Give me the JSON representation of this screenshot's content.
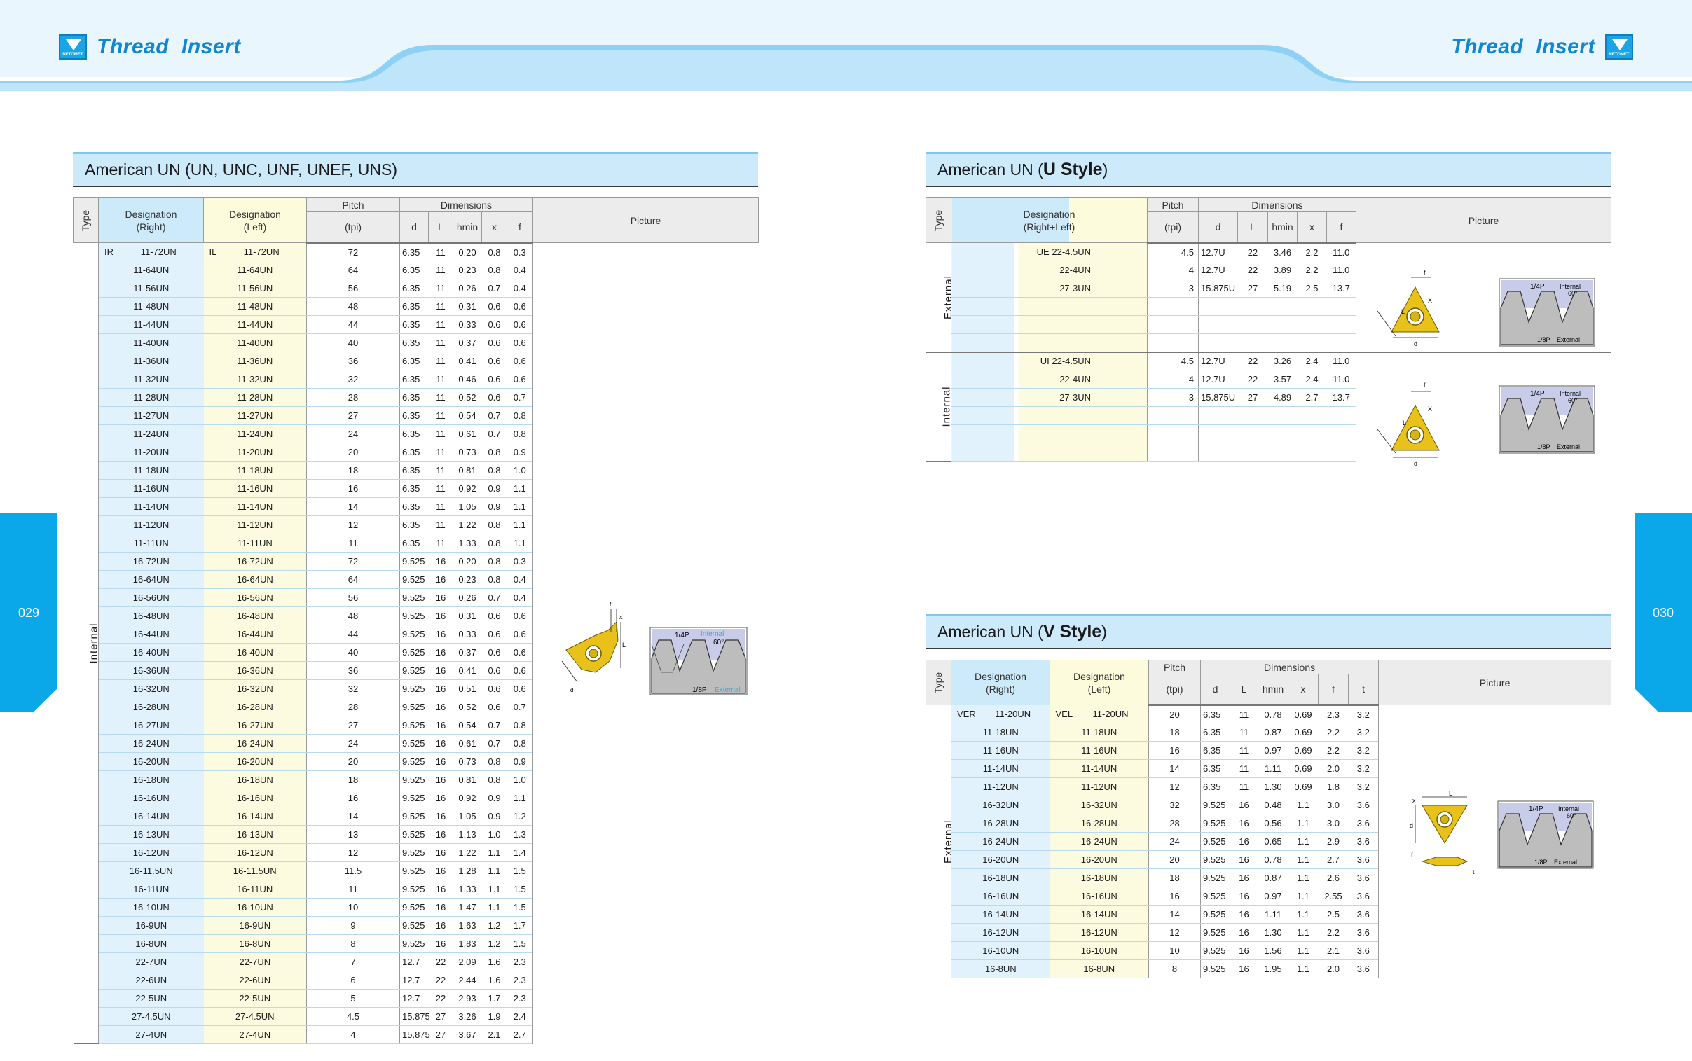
{
  "header": {
    "brand_left": {
      "word1": "Thread",
      "word2": "Insert"
    },
    "brand_right": {
      "word1": "Thread",
      "word2": "Insert"
    },
    "logo_text": "NETOMET"
  },
  "pages": {
    "left": "029",
    "right": "030"
  },
  "colors": {
    "accent": "#0aa8e8",
    "title_bar": "#cdeafb",
    "right_cell": "#e2f2fd",
    "left_cell": "#fcfbe0",
    "insert_gold": "#e8c21a"
  },
  "un_table": {
    "title": "American UN (UN, UNC, UNF, UNEF, UNS)",
    "headers": {
      "type": "Type",
      "designation_right": "Designation\n(Right)",
      "designation_left": "Designation\n(Left)",
      "pitch": "Pitch",
      "tpi": "(tpi)",
      "dimensions": "Dimensions",
      "d": "d",
      "L": "L",
      "hmin": "hmin",
      "x": "x",
      "f": "f",
      "picture": "Picture"
    },
    "type_label": "Internal",
    "prefix_right": "IR",
    "prefix_left": "IL",
    "rows": [
      [
        "11-72UN",
        "11-72UN",
        "72",
        "6.35",
        "11",
        "0.20",
        "0.8",
        "0.3"
      ],
      [
        "11-64UN",
        "11-64UN",
        "64",
        "6.35",
        "11",
        "0.23",
        "0.8",
        "0.4"
      ],
      [
        "11-56UN",
        "11-56UN",
        "56",
        "6.35",
        "11",
        "0.26",
        "0.7",
        "0.4"
      ],
      [
        "11-48UN",
        "11-48UN",
        "48",
        "6.35",
        "11",
        "0.31",
        "0.6",
        "0.6"
      ],
      [
        "11-44UN",
        "11-44UN",
        "44",
        "6.35",
        "11",
        "0.33",
        "0.6",
        "0.6"
      ],
      [
        "11-40UN",
        "11-40UN",
        "40",
        "6.35",
        "11",
        "0.37",
        "0.6",
        "0.6"
      ],
      [
        "11-36UN",
        "11-36UN",
        "36",
        "6.35",
        "11",
        "0.41",
        "0.6",
        "0.6"
      ],
      [
        "11-32UN",
        "11-32UN",
        "32",
        "6.35",
        "11",
        "0.46",
        "0.6",
        "0.6"
      ],
      [
        "11-28UN",
        "11-28UN",
        "28",
        "6.35",
        "11",
        "0.52",
        "0.6",
        "0.7"
      ],
      [
        "11-27UN",
        "11-27UN",
        "27",
        "6.35",
        "11",
        "0.54",
        "0.7",
        "0.8"
      ],
      [
        "11-24UN",
        "11-24UN",
        "24",
        "6.35",
        "11",
        "0.61",
        "0.7",
        "0.8"
      ],
      [
        "11-20UN",
        "11-20UN",
        "20",
        "6.35",
        "11",
        "0.73",
        "0.8",
        "0.9"
      ],
      [
        "11-18UN",
        "11-18UN",
        "18",
        "6.35",
        "11",
        "0.81",
        "0.8",
        "1.0"
      ],
      [
        "11-16UN",
        "11-16UN",
        "16",
        "6.35",
        "11",
        "0.92",
        "0.9",
        "1.1"
      ],
      [
        "11-14UN",
        "11-14UN",
        "14",
        "6.35",
        "11",
        "1.05",
        "0.9",
        "1.1"
      ],
      [
        "11-12UN",
        "11-12UN",
        "12",
        "6.35",
        "11",
        "1.22",
        "0.8",
        "1.1"
      ],
      [
        "11-11UN",
        "11-11UN",
        "11",
        "6.35",
        "11",
        "1.33",
        "0.8",
        "1.1"
      ],
      [
        "16-72UN",
        "16-72UN",
        "72",
        "9.525",
        "16",
        "0.20",
        "0.8",
        "0.3"
      ],
      [
        "16-64UN",
        "16-64UN",
        "64",
        "9.525",
        "16",
        "0.23",
        "0.8",
        "0.4"
      ],
      [
        "16-56UN",
        "16-56UN",
        "56",
        "9.525",
        "16",
        "0.26",
        "0.7",
        "0.4"
      ],
      [
        "16-48UN",
        "16-48UN",
        "48",
        "9.525",
        "16",
        "0.31",
        "0.6",
        "0.6"
      ],
      [
        "16-44UN",
        "16-44UN",
        "44",
        "9.525",
        "16",
        "0.33",
        "0.6",
        "0.6"
      ],
      [
        "16-40UN",
        "16-40UN",
        "40",
        "9.525",
        "16",
        "0.37",
        "0.6",
        "0.6"
      ],
      [
        "16-36UN",
        "16-36UN",
        "36",
        "9.525",
        "16",
        "0.41",
        "0.6",
        "0.6"
      ],
      [
        "16-32UN",
        "16-32UN",
        "32",
        "9.525",
        "16",
        "0.51",
        "0.6",
        "0.6"
      ],
      [
        "16-28UN",
        "16-28UN",
        "28",
        "9.525",
        "16",
        "0.52",
        "0.6",
        "0.7"
      ],
      [
        "16-27UN",
        "16-27UN",
        "27",
        "9.525",
        "16",
        "0.54",
        "0.7",
        "0.8"
      ],
      [
        "16-24UN",
        "16-24UN",
        "24",
        "9.525",
        "16",
        "0.61",
        "0.7",
        "0.8"
      ],
      [
        "16-20UN",
        "16-20UN",
        "20",
        "9.525",
        "16",
        "0.73",
        "0.8",
        "0.9"
      ],
      [
        "16-18UN",
        "16-18UN",
        "18",
        "9.525",
        "16",
        "0.81",
        "0.8",
        "1.0"
      ],
      [
        "16-16UN",
        "16-16UN",
        "16",
        "9.525",
        "16",
        "0.92",
        "0.9",
        "1.1"
      ],
      [
        "16-14UN",
        "16-14UN",
        "14",
        "9.525",
        "16",
        "1.05",
        "0.9",
        "1.2"
      ],
      [
        "16-13UN",
        "16-13UN",
        "13",
        "9.525",
        "16",
        "1.13",
        "1.0",
        "1.3"
      ],
      [
        "16-12UN",
        "16-12UN",
        "12",
        "9.525",
        "16",
        "1.22",
        "1.1",
        "1.4"
      ],
      [
        "16-11.5UN",
        "16-11.5UN",
        "11.5",
        "9.525",
        "16",
        "1.28",
        "1.1",
        "1.5"
      ],
      [
        "16-11UN",
        "16-11UN",
        "11",
        "9.525",
        "16",
        "1.33",
        "1.1",
        "1.5"
      ],
      [
        "16-10UN",
        "16-10UN",
        "10",
        "9.525",
        "16",
        "1.47",
        "1.1",
        "1.5"
      ],
      [
        "16-9UN",
        "16-9UN",
        "9",
        "9.525",
        "16",
        "1.63",
        "1.2",
        "1.7"
      ],
      [
        "16-8UN",
        "16-8UN",
        "8",
        "9.525",
        "16",
        "1.83",
        "1.2",
        "1.5"
      ],
      [
        "22-7UN",
        "22-7UN",
        "7",
        "12.7",
        "22",
        "2.09",
        "1.6",
        "2.3"
      ],
      [
        "22-6UN",
        "22-6UN",
        "6",
        "12.7",
        "22",
        "2.44",
        "1.6",
        "2.3"
      ],
      [
        "22-5UN",
        "22-5UN",
        "5",
        "12.7",
        "22",
        "2.93",
        "1.7",
        "2.3"
      ],
      [
        "27-4.5UN",
        "27-4.5UN",
        "4.5",
        "15.875",
        "27",
        "3.26",
        "1.9",
        "2.4"
      ],
      [
        "27-4UN",
        "27-4UN",
        "4",
        "15.875",
        "27",
        "3.67",
        "2.1",
        "2.7"
      ]
    ],
    "diagram": {
      "quarter_p": "1/4P",
      "internal": "Internal",
      "angle": "60°",
      "eighth_p": "1/8P",
      "external": "External",
      "x": "x",
      "f": "f",
      "L": "L",
      "d": "d"
    }
  },
  "u_table": {
    "title_pre": "American UN (",
    "title_bold": "U Style",
    "title_post": ")",
    "headers": {
      "type": "Type",
      "designation": "Designation\n(Right+Left)",
      "pitch": "Pitch",
      "tpi": "(tpi)",
      "dimensions": "Dimensions",
      "d": "d",
      "L": "L",
      "hmin": "hmin",
      "x": "x",
      "f": "f",
      "picture": "Picture"
    },
    "external": {
      "label": "External",
      "prefix": "UE",
      "rows": [
        [
          "22-4.5UN",
          "4.5",
          "12.7U",
          "22",
          "3.46",
          "2.2",
          "11.0"
        ],
        [
          "22-4UN",
          "4",
          "12.7U",
          "22",
          "3.89",
          "2.2",
          "11.0"
        ],
        [
          "27-3UN",
          "3",
          "15.875U",
          "27",
          "5.19",
          "2.5",
          "13.7"
        ]
      ]
    },
    "internal": {
      "label": "Internal",
      "prefix": "UI",
      "rows": [
        [
          "22-4.5UN",
          "4.5",
          "12.7U",
          "22",
          "3.26",
          "2.4",
          "11.0"
        ],
        [
          "22-4UN",
          "4",
          "12.7U",
          "22",
          "3.57",
          "2.4",
          "11.0"
        ],
        [
          "27-3UN",
          "3",
          "15.875U",
          "27",
          "4.89",
          "2.7",
          "13.7"
        ]
      ]
    },
    "diagram": {
      "quarter_p": "1/4P",
      "internal": "Internal",
      "angle": "60°",
      "eighth_p": "1/8P",
      "external": "External",
      "x": "X",
      "f": "f",
      "L": "L",
      "d": "d"
    }
  },
  "v_table": {
    "title_pre": "American UN (",
    "title_bold": "V Style",
    "title_post": ")",
    "headers": {
      "type": "Type",
      "designation_right": "Designation\n(Right)",
      "designation_left": "Designation\n(Left)",
      "pitch": "Pitch",
      "tpi": "(tpi)",
      "dimensions": "Dimensions",
      "d": "d",
      "L": "L",
      "hmin": "hmin",
      "x": "x",
      "f": "f",
      "t": "t",
      "picture": "Picture"
    },
    "type_label": "External",
    "prefix_right": "VER",
    "prefix_left": "VEL",
    "rows": [
      [
        "11-20UN",
        "11-20UN",
        "20",
        "6.35",
        "11",
        "0.78",
        "0.69",
        "2.3",
        "3.2"
      ],
      [
        "11-18UN",
        "11-18UN",
        "18",
        "6.35",
        "11",
        "0.87",
        "0.69",
        "2.2",
        "3.2"
      ],
      [
        "11-16UN",
        "11-16UN",
        "16",
        "6.35",
        "11",
        "0.97",
        "0.69",
        "2.2",
        "3.2"
      ],
      [
        "11-14UN",
        "11-14UN",
        "14",
        "6.35",
        "11",
        "1.11",
        "0.69",
        "2.0",
        "3.2"
      ],
      [
        "11-12UN",
        "11-12UN",
        "12",
        "6.35",
        "11",
        "1.30",
        "0.69",
        "1.8",
        "3.2"
      ],
      [
        "16-32UN",
        "16-32UN",
        "32",
        "9.525",
        "16",
        "0.48",
        "1.1",
        "3.0",
        "3.6"
      ],
      [
        "16-28UN",
        "16-28UN",
        "28",
        "9.525",
        "16",
        "0.56",
        "1.1",
        "3.0",
        "3.6"
      ],
      [
        "16-24UN",
        "16-24UN",
        "24",
        "9.525",
        "16",
        "0.65",
        "1.1",
        "2.9",
        "3.6"
      ],
      [
        "16-20UN",
        "16-20UN",
        "20",
        "9.525",
        "16",
        "0.78",
        "1.1",
        "2.7",
        "3.6"
      ],
      [
        "16-18UN",
        "16-18UN",
        "18",
        "9.525",
        "16",
        "0.87",
        "1.1",
        "2.6",
        "3.6"
      ],
      [
        "16-16UN",
        "16-16UN",
        "16",
        "9.525",
        "16",
        "0.97",
        "1.1",
        "2.55",
        "3.6"
      ],
      [
        "16-14UN",
        "16-14UN",
        "14",
        "9.525",
        "16",
        "1.11",
        "1.1",
        "2.5",
        "3.6"
      ],
      [
        "16-12UN",
        "16-12UN",
        "12",
        "9.525",
        "16",
        "1.30",
        "1.1",
        "2.2",
        "3.6"
      ],
      [
        "16-10UN",
        "16-10UN",
        "10",
        "9.525",
        "16",
        "1.56",
        "1.1",
        "2.1",
        "3.6"
      ],
      [
        "16-8UN",
        "16-8UN",
        "8",
        "9.525",
        "16",
        "1.95",
        "1.1",
        "2.0",
        "3.6"
      ]
    ],
    "diagram": {
      "quarter_p": "1/4P",
      "internal": "Internal",
      "angle": "60°",
      "eighth_p": "1/8P",
      "external": "External",
      "x": "x",
      "f": "f",
      "L": "L",
      "d": "d",
      "t": "t"
    }
  }
}
